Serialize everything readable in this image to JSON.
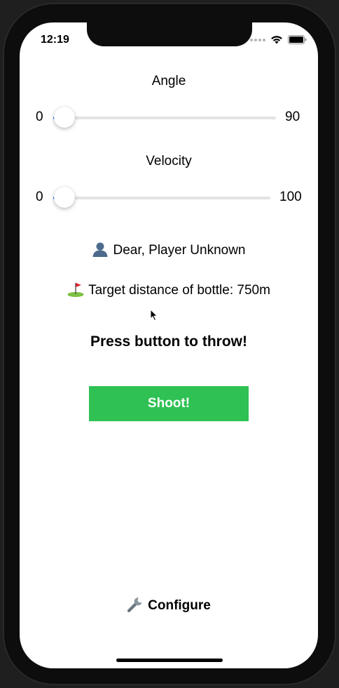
{
  "status_bar": {
    "time": "12:19"
  },
  "angle": {
    "label": "Angle",
    "min": "0",
    "max": "90",
    "value_fraction": 0
  },
  "velocity": {
    "label": "Velocity",
    "min": "0",
    "max": "100",
    "value_fraction": 0
  },
  "player": {
    "icon": "person-silhouette-icon",
    "text": "Dear, Player Unknown"
  },
  "target": {
    "icon": "golf-flag-icon",
    "text": "Target distance of bottle: 750m"
  },
  "instruction": "Press button to throw!",
  "shoot_button": {
    "label": "Shoot!",
    "color": "#2fc153"
  },
  "configure": {
    "icon": "wrench-icon",
    "label": "Configure"
  },
  "colors": {
    "slider_track": "#e3e3e3",
    "slider_fill": "#1e7cf0",
    "bezel": "#0d0d0d"
  }
}
